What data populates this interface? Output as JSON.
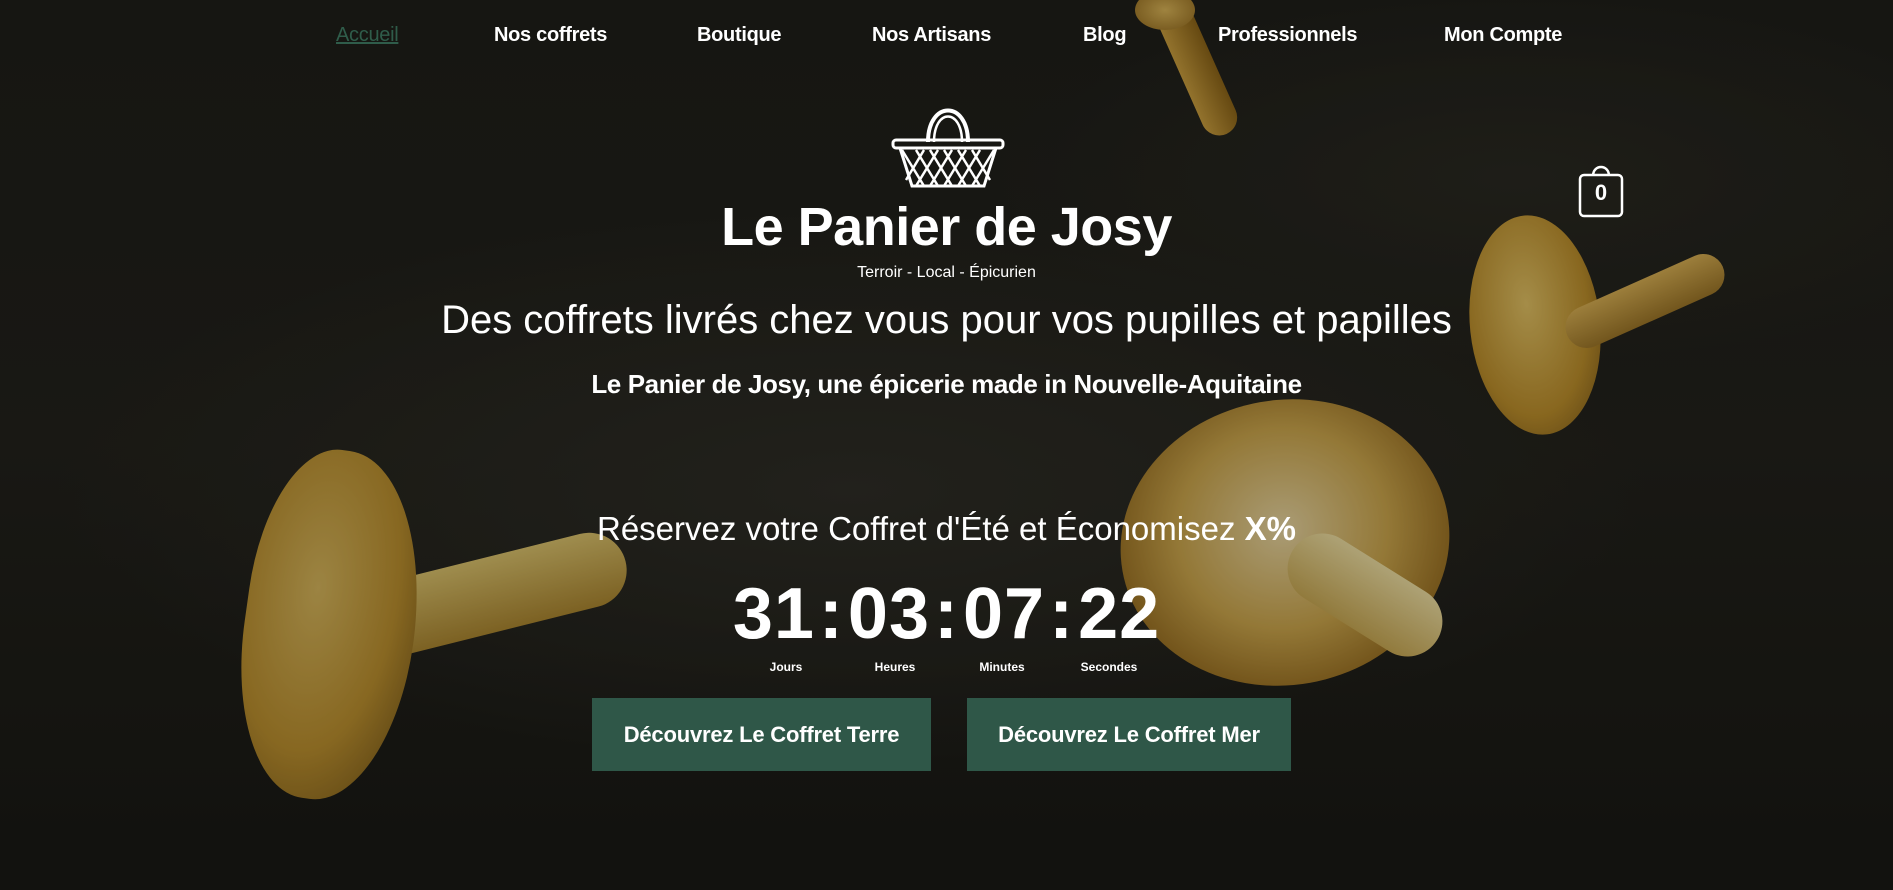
{
  "nav": {
    "items": [
      {
        "label": "Accueil"
      },
      {
        "label": "Nos coffrets"
      },
      {
        "label": "Boutique"
      },
      {
        "label": "Nos Artisans"
      },
      {
        "label": "Blog"
      },
      {
        "label": "Professionnels"
      },
      {
        "label": "Mon Compte"
      }
    ]
  },
  "hero": {
    "logo_icon": "basket-icon",
    "brand": "Le Panier de Josy",
    "tagline": "Terroir - Local - Épicurien",
    "headline": "Des coffrets livrés chez vous pour vos pupilles et papilles",
    "subhead": "Le Panier de Josy, une épicerie made in Nouvelle-Aquitaine"
  },
  "cart": {
    "icon": "shopping-bag-icon",
    "count": "0"
  },
  "promo": {
    "text": "Réservez votre Coffret d'Été et Économisez",
    "highlight": "X%"
  },
  "countdown": {
    "days": "31",
    "hours": "03",
    "minutes": "07",
    "seconds": "22",
    "labels": {
      "days": "Jours",
      "hours": "Heures",
      "minutes": "Minutes",
      "seconds": "Secondes"
    }
  },
  "buttons": {
    "terre": "Découvrez Le Coffret Terre",
    "mer": "Découvrez Le Coffret Mer"
  },
  "colors": {
    "accent": "#2f5748",
    "active_link": "#2f5c4a",
    "background": "#1d1c18"
  }
}
